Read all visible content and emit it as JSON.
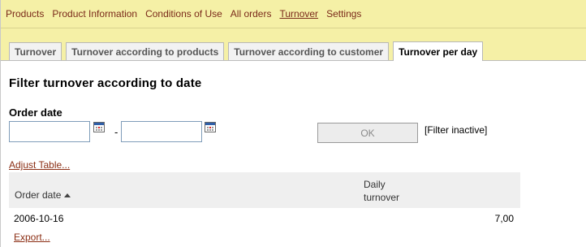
{
  "nav": {
    "items": [
      {
        "label": "Products"
      },
      {
        "label": "Product Information"
      },
      {
        "label": "Conditions of Use"
      },
      {
        "label": "All orders"
      },
      {
        "label": "Turnover",
        "active": true
      },
      {
        "label": "Settings"
      }
    ]
  },
  "tabs": [
    {
      "label": "Turnover"
    },
    {
      "label": "Turnover according to products"
    },
    {
      "label": "Turnover according to customer"
    },
    {
      "label": "Turnover per day",
      "active": true
    }
  ],
  "filter": {
    "title": "Filter turnover according to date",
    "order_date_label": "Order date",
    "date_from_value": "",
    "date_to_value": "",
    "separator": "-",
    "ok_label": "OK",
    "status": "[Filter inactive]"
  },
  "links": {
    "adjust_table": "Adjust Table...",
    "export": "Export..."
  },
  "table": {
    "columns": {
      "order_date": "Order date",
      "daily_turnover_line1": "Daily",
      "daily_turnover_line2": "turnover"
    },
    "rows": [
      {
        "order_date": "2006-10-16",
        "daily_turnover": "7,00"
      }
    ]
  },
  "colors": {
    "nav_background": "#f5f0a6",
    "link_color": "#8b2e14",
    "table_header_bg": "#efefef"
  }
}
